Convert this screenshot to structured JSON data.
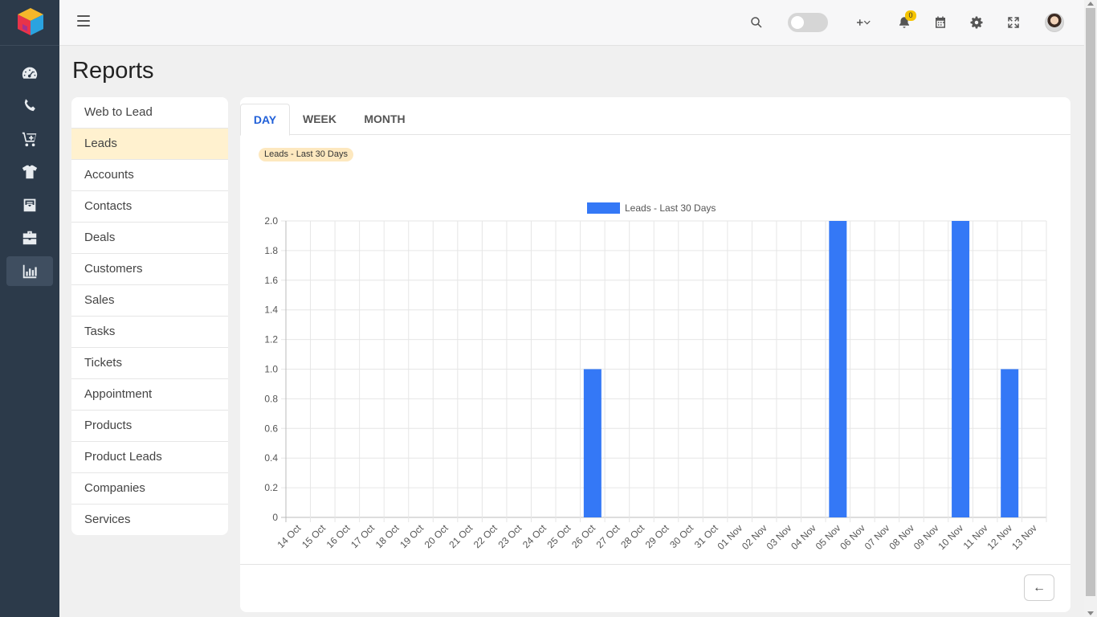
{
  "rail": {
    "items": [
      {
        "icon": "dashboard-icon"
      },
      {
        "icon": "phone-icon"
      },
      {
        "icon": "cart-icon"
      },
      {
        "icon": "tshirt-icon"
      },
      {
        "icon": "mail-box-icon"
      },
      {
        "icon": "briefcase-icon"
      },
      {
        "icon": "bar-chart-icon",
        "active": true
      }
    ]
  },
  "topbar": {
    "notifications_count": "0"
  },
  "page": {
    "title": "Reports"
  },
  "menu": {
    "items": [
      {
        "label": "Web to Lead"
      },
      {
        "label": "Leads",
        "active": true
      },
      {
        "label": "Accounts"
      },
      {
        "label": "Contacts"
      },
      {
        "label": "Deals"
      },
      {
        "label": "Customers"
      },
      {
        "label": "Sales"
      },
      {
        "label": "Tasks"
      },
      {
        "label": "Tickets"
      },
      {
        "label": "Appointment"
      },
      {
        "label": "Products"
      },
      {
        "label": "Product Leads"
      },
      {
        "label": "Companies"
      },
      {
        "label": "Services"
      }
    ]
  },
  "tabs": [
    {
      "label": "DAY",
      "active": true
    },
    {
      "label": "WEEK"
    },
    {
      "label": "MONTH"
    }
  ],
  "report_label": "Leads - Last 30 Days",
  "back_button": "←",
  "colors": {
    "bar": "#3478f6",
    "rail": "#2c3a4a",
    "active_menu": "#fff1cf",
    "active_tab": "#2160d8"
  },
  "chart_data": {
    "type": "bar",
    "legend_position": "top",
    "grid": true,
    "ylim": [
      0,
      2
    ],
    "yticks": [
      "0",
      "0.2",
      "0.4",
      "0.6",
      "0.8",
      "1.0",
      "1.2",
      "1.4",
      "1.6",
      "1.8",
      "2.0"
    ],
    "categories": [
      "14 Oct",
      "15 Oct",
      "16 Oct",
      "17 Oct",
      "18 Oct",
      "19 Oct",
      "20 Oct",
      "21 Oct",
      "22 Oct",
      "23 Oct",
      "24 Oct",
      "25 Oct",
      "26 Oct",
      "27 Oct",
      "28 Oct",
      "29 Oct",
      "30 Oct",
      "31 Oct",
      "01 Nov",
      "02 Nov",
      "03 Nov",
      "04 Nov",
      "05 Nov",
      "06 Nov",
      "07 Nov",
      "08 Nov",
      "09 Nov",
      "10 Nov",
      "11 Nov",
      "12 Nov",
      "13 Nov"
    ],
    "series": [
      {
        "name": "Leads - Last 30 Days",
        "values": [
          0,
          0,
          0,
          0,
          0,
          0,
          0,
          0,
          0,
          0,
          0,
          0,
          1,
          0,
          0,
          0,
          0,
          0,
          0,
          0,
          0,
          0,
          2,
          0,
          0,
          0,
          0,
          2,
          0,
          1,
          0
        ]
      }
    ]
  }
}
